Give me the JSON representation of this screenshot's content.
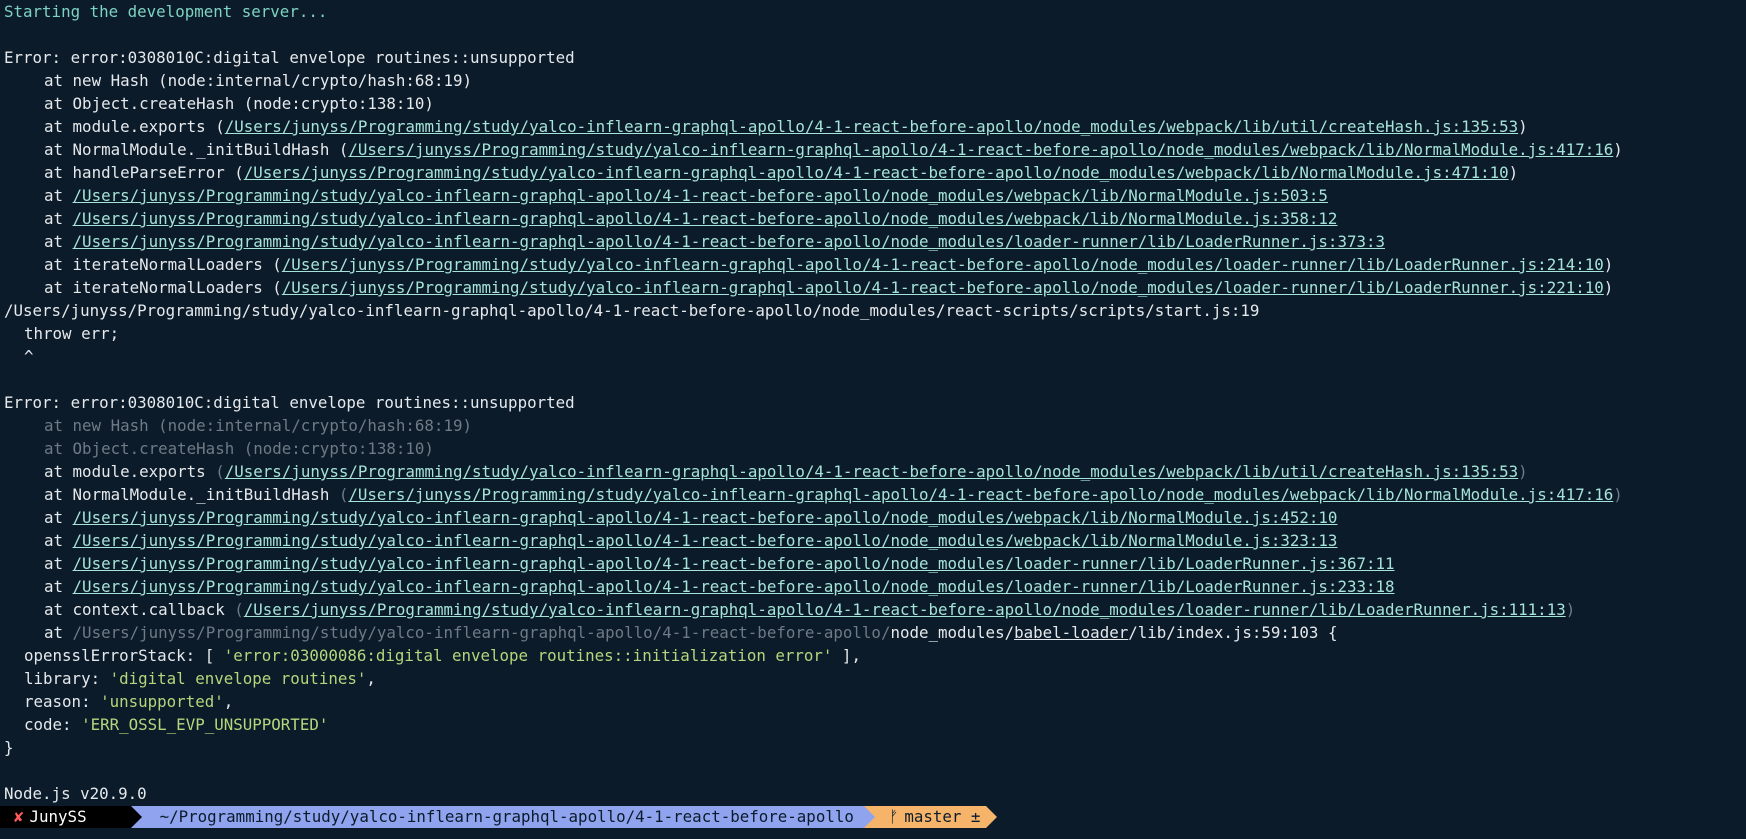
{
  "terminal": {
    "start_msg": "Starting the development server...",
    "err1": {
      "header": "Error: error:0308010C:digital envelope routines::unsupported",
      "at": "at",
      "f1": "new Hash (node:internal/crypto/hash:68:19)",
      "f2": "Object.createHash (node:crypto:138:10)",
      "f3_fn": "module.exports",
      "f3_path": "/Users/junyss/Programming/study/yalco-inflearn-graphql-apollo/4-1-react-before-apollo/node_modules/webpack/lib/util/createHash.js:135:53",
      "f4_fn": "NormalModule._initBuildHash",
      "f4_path": "/Users/junyss/Programming/study/yalco-inflearn-graphql-apollo/4-1-react-before-apollo/node_modules/webpack/lib/NormalModule.js:417:16",
      "f5_fn": "handleParseError",
      "f5_path": "/Users/junyss/Programming/study/yalco-inflearn-graphql-apollo/4-1-react-before-apollo/node_modules/webpack/lib/NormalModule.js:471:10",
      "f6_path": "/Users/junyss/Programming/study/yalco-inflearn-graphql-apollo/4-1-react-before-apollo/node_modules/webpack/lib/NormalModule.js:503:5",
      "f7_path": "/Users/junyss/Programming/study/yalco-inflearn-graphql-apollo/4-1-react-before-apollo/node_modules/webpack/lib/NormalModule.js:358:12",
      "f8_path": "/Users/junyss/Programming/study/yalco-inflearn-graphql-apollo/4-1-react-before-apollo/node_modules/loader-runner/lib/LoaderRunner.js:373:3",
      "f9_fn": "iterateNormalLoaders",
      "f9_path": "/Users/junyss/Programming/study/yalco-inflearn-graphql-apollo/4-1-react-before-apollo/node_modules/loader-runner/lib/LoaderRunner.js:214:10",
      "f10_fn": "iterateNormalLoaders",
      "f10_path": "/Users/junyss/Programming/study/yalco-inflearn-graphql-apollo/4-1-react-before-apollo/node_modules/loader-runner/lib/LoaderRunner.js:221:10"
    },
    "start_js": "/Users/junyss/Programming/study/yalco-inflearn-graphql-apollo/4-1-react-before-apollo/node_modules/react-scripts/scripts/start.js:19",
    "throw": "throw err;",
    "caret": "^",
    "err2": {
      "header": "Error: error:0308010C:digital envelope routines::unsupported",
      "f1": "at new Hash (node:internal/crypto/hash:68:19)",
      "f2": "at Object.createHash (node:crypto:138:10)",
      "f3_fn": "module.exports",
      "f3_path": "/Users/junyss/Programming/study/yalco-inflearn-graphql-apollo/4-1-react-before-apollo/node_modules/webpack/lib/util/createHash.js:135:53",
      "f4_fn": "NormalModule._initBuildHash",
      "f4_path": "/Users/junyss/Programming/study/yalco-inflearn-graphql-apollo/4-1-react-before-apollo/node_modules/webpack/lib/NormalModule.js:417:16",
      "f5_path": "/Users/junyss/Programming/study/yalco-inflearn-graphql-apollo/4-1-react-before-apollo/node_modules/webpack/lib/NormalModule.js:452:10",
      "f6_path": "/Users/junyss/Programming/study/yalco-inflearn-graphql-apollo/4-1-react-before-apollo/node_modules/webpack/lib/NormalModule.js:323:13",
      "f7_path": "/Users/junyss/Programming/study/yalco-inflearn-graphql-apollo/4-1-react-before-apollo/node_modules/loader-runner/lib/LoaderRunner.js:367:11",
      "f8_path": "/Users/junyss/Programming/study/yalco-inflearn-graphql-apollo/4-1-react-before-apollo/node_modules/loader-runner/lib/LoaderRunner.js:233:18",
      "f9_fn": "context.callback",
      "f9_path": "/Users/junyss/Programming/study/yalco-inflearn-graphql-apollo/4-1-react-before-apollo/node_modules/loader-runner/lib/LoaderRunner.js:111:13",
      "f10_dim": "/Users/junyss/Programming/study/yalco-inflearn-graphql-apollo/4-1-react-before-apollo/",
      "f10_nm": "node_modules/",
      "f10_babel": "babel-loader",
      "f10_rest": "/lib/index.js:59:103 {",
      "opensslErrorStack_key": "opensslErrorStack: [ ",
      "opensslErrorStack_val": "'error:03000086:digital envelope routines::initialization error'",
      "opensslErrorStack_end": " ],",
      "library_key": "library: ",
      "library_val": "'digital envelope routines'",
      "reason_key": "reason: ",
      "reason_val": "'unsupported'",
      "code_key": "code: ",
      "code_val": "'ERR_OSSL_EVP_UNSUPPORTED'",
      "close": "}"
    },
    "node_version": "Node.js v20.9.0"
  },
  "prompt": {
    "status_icon": "✘",
    "user": "JunySS",
    "path": "~/Programming/study/yalco-inflearn-graphql-apollo/4-1-react-before-apollo",
    "branch_icon": "ᚠ",
    "branch": "master ±"
  },
  "colors": {
    "background": "#0b1b2a",
    "link": "#a6e3d8",
    "string": "#b5d67c",
    "path_segment": "#8fa3ee",
    "git_segment": "#f5b46a"
  }
}
